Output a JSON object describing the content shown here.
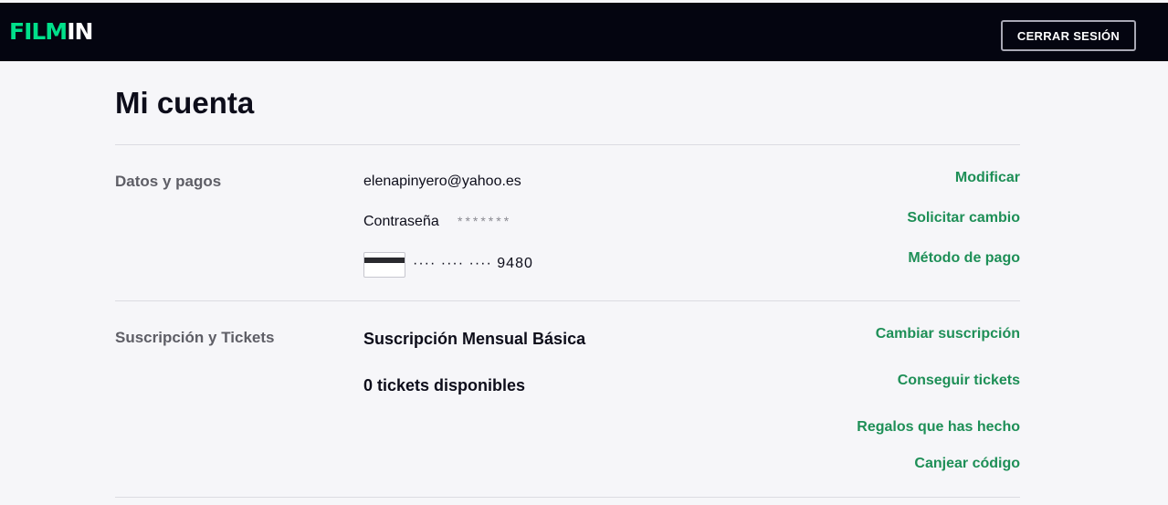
{
  "header": {
    "logo_part1": "FILM",
    "logo_part2": "IN",
    "logout_label": "CERRAR SESIÓN"
  },
  "page": {
    "title": "Mi cuenta"
  },
  "account": {
    "label": "Datos y pagos",
    "email": "elenapinyero@yahoo.es",
    "password_label": "Contraseña",
    "password_mask": "*******",
    "card_masked": "···· ···· ···· 9480",
    "links": {
      "modify": "Modificar",
      "request_change": "Solicitar cambio",
      "payment_method": "Método de pago"
    }
  },
  "subscription": {
    "label": "Suscripción y Tickets",
    "plan": "Suscripción Mensual Básica",
    "tickets": "0 tickets disponibles",
    "links": {
      "change_subscription": "Cambiar suscripción",
      "get_tickets": "Conseguir tickets",
      "gifts": "Regalos que has hecho",
      "redeem": "Canjear código"
    }
  }
}
